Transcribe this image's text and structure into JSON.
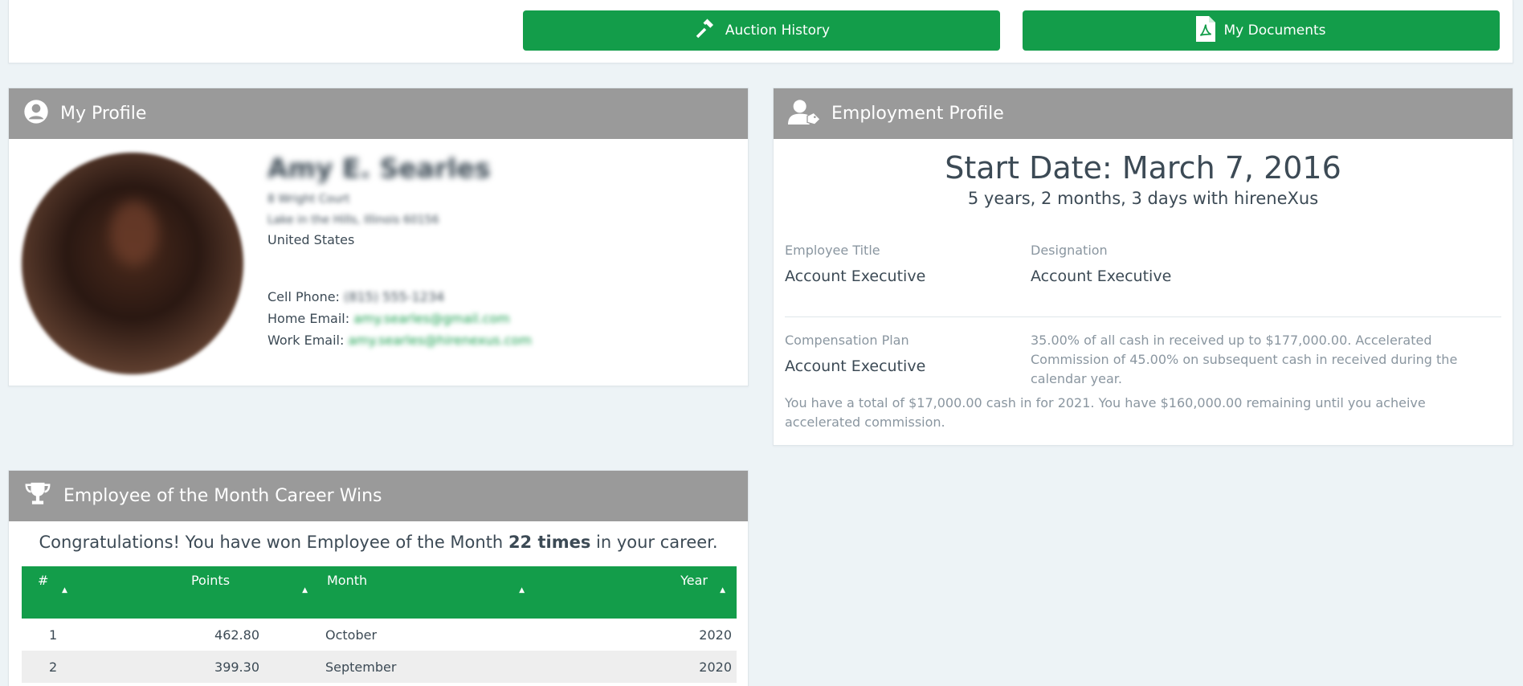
{
  "topbar": {
    "auction_label": "Auction History",
    "documents_label": "My Documents"
  },
  "profile": {
    "title": "My Profile",
    "name": "Amy E. Searles",
    "address1": "8 Wright Court",
    "address2": "Lake in the Hills, Illinois 60156",
    "country": "United States",
    "cell_label": "Cell Phone:",
    "cell_value": "(815) 555-1234",
    "home_email_label": "Home Email:",
    "home_email_value": "amy.searles@gmail.com",
    "work_email_label": "Work Email:",
    "work_email_value": "amy.searles@hirenexus.com"
  },
  "employment": {
    "title": "Employment Profile",
    "start_date": "Start Date: March 7, 2016",
    "tenure": "5 years, 2 months, 3 days with hireneXus",
    "employee_title_label": "Employee Title",
    "employee_title_value": "Account Executive",
    "designation_label": "Designation",
    "designation_value": "Account Executive",
    "comp_plan_label": "Compensation Plan",
    "comp_plan_value": "Account Executive",
    "comp_plan_desc": "35.00% of all cash in received up to $177,000.00. Accelerated Commission of 45.00% on subsequent cash in received during the calendar year.",
    "comp_total": "You have a total of $17,000.00 cash in for 2021. You have $160,000.00 remaining until you acheive accelerated commission."
  },
  "eotm": {
    "title": "Employee of the Month Career Wins",
    "congrats_pre": "Congratulations! You have won Employee of the Month",
    "congrats_count": "22 times",
    "congrats_post": "in your career.",
    "columns": [
      "#",
      "Points",
      "Month",
      "Year"
    ],
    "rows": [
      {
        "num": "1",
        "points": "462.80",
        "month": "October",
        "year": "2020"
      },
      {
        "num": "2",
        "points": "399.30",
        "month": "September",
        "year": "2020"
      }
    ]
  }
}
